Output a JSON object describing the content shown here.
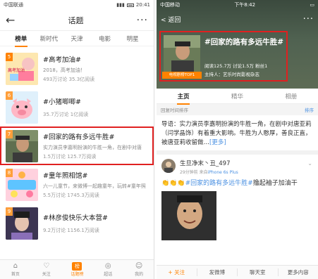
{
  "left": {
    "status": {
      "carrier": "中国联通",
      "time": "20:41"
    },
    "header": {
      "title": "话题"
    },
    "tabs": [
      "榜单",
      "新时代",
      "天津",
      "电影",
      "明星"
    ],
    "items": [
      {
        "rank": "5",
        "name": "#高考加油#",
        "desc": "2018，高考加油！",
        "stat": "493万讨论   35.3亿阅读"
      },
      {
        "rank": "6",
        "name": "#小猪唧唧#",
        "desc": "",
        "stat": "35.7万讨论   1亿阅读"
      },
      {
        "rank": "7",
        "name": "#回家的路有多远牛胜#",
        "desc": "实力演员李嘉明扮演的牛胜一角，在剧中对唐",
        "stat": "1.5万讨论   125.7万阅读"
      },
      {
        "rank": "8",
        "name": "#童年照相馆#",
        "desc": "六一儿童节，来微博一起趣童年，玩转#童年照",
        "stat": "5.5万讨论   1745.3万阅读"
      },
      {
        "rank": "9",
        "name": "#林彦俊快乐大本营#",
        "desc": "",
        "stat": "9.2万讨论   1156.1万阅读"
      }
    ],
    "thumb_labels": {
      "t5": "高考加油"
    },
    "bottom_nav": [
      {
        "label": "首页",
        "icon": "⌂"
      },
      {
        "label": "关注",
        "icon": "♡"
      },
      {
        "label": "话题榜",
        "icon": "榜"
      },
      {
        "label": "超话",
        "icon": "◎"
      },
      {
        "label": "我的",
        "icon": "☺"
      }
    ]
  },
  "right": {
    "status": {
      "carrier": "中国移动",
      "time": "下午8:42"
    },
    "nav": {
      "back_label": "返回"
    },
    "topic": {
      "title": "#回家的路有多远牛胜#",
      "badge": "电视剧榜TOP1",
      "meta": "阅读125.7万  讨论1.5万  粉丝1",
      "host": "主持人：艺乐时尚影视杂志"
    },
    "tabs": [
      "主页",
      "精华",
      "相册"
    ],
    "sort": {
      "label": "回复时间排序",
      "link": "排序"
    },
    "intro": {
      "text": "导语：实力演员李嘉明扮演的牛胜一角，在剧中对唐亚莉（闫学晶饰）有着重大影响。牛胜为人憨厚，善良正直，被唐亚莉收留做…",
      "more": "[更多]"
    },
    "post": {
      "user": "生旦净末丶丑_497",
      "time": "29分钟前",
      "device_prefix": "来自",
      "device": "iPhone 6s Plus",
      "emoji": "👏👏👏",
      "topic": "#回家的路有多远牛胜#",
      "text": "撸起袖子加油干"
    },
    "bottom": [
      {
        "label": "+ 关注"
      },
      {
        "label": "发微博"
      },
      {
        "label": "聊天室"
      },
      {
        "label": "更多内容"
      }
    ]
  },
  "colors": {
    "accent": "#ff8200",
    "highlight": "#e02020",
    "link": "#4a90e2"
  }
}
